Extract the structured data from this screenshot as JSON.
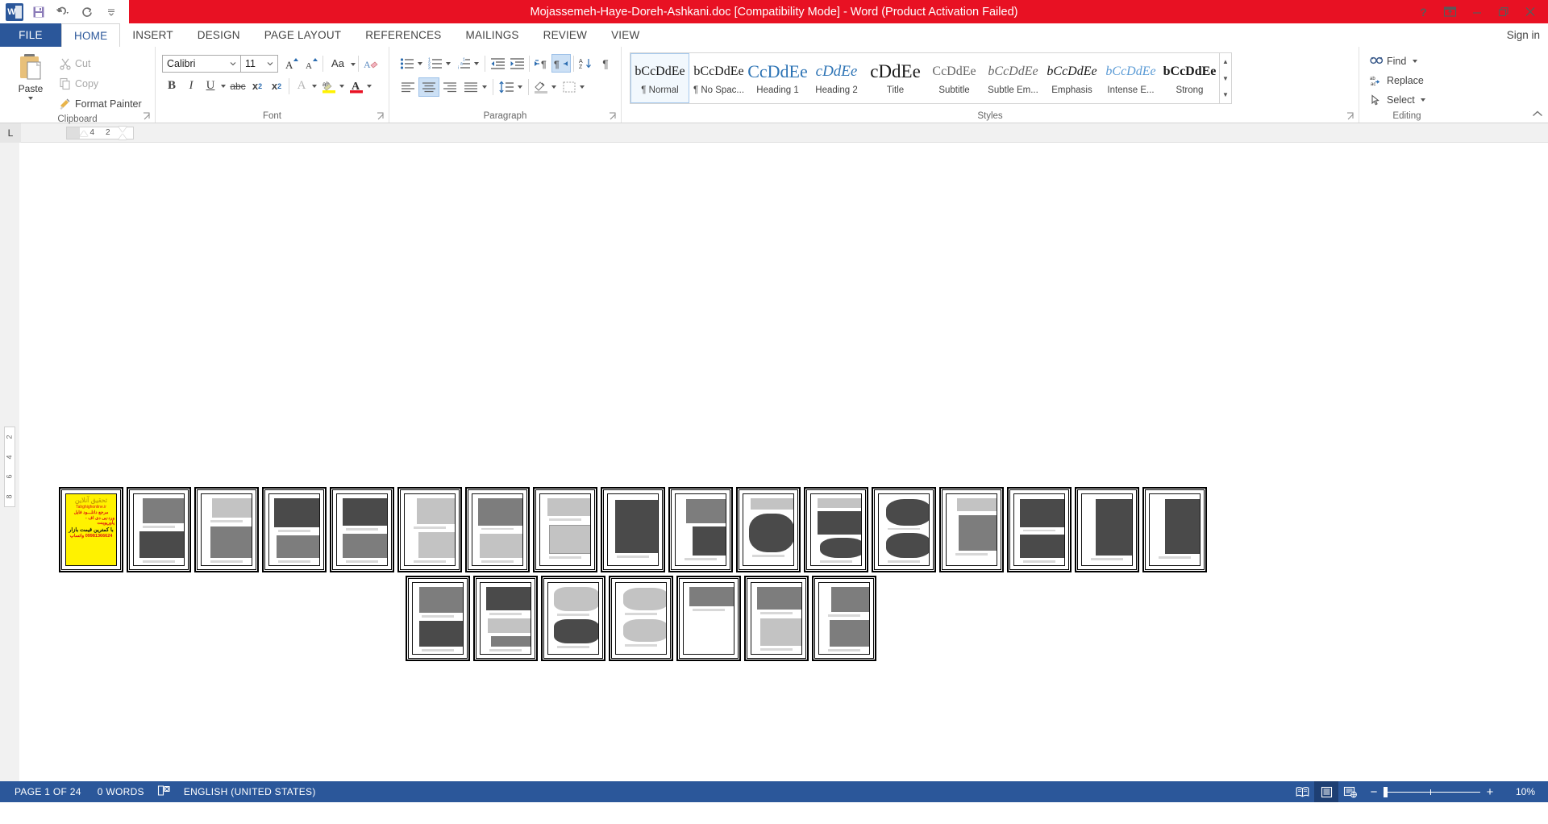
{
  "titlebar": {
    "document_title": "Mojassemeh-Haye-Doreh-Ashkani.doc [Compatibility Mode]  -  Word (Product Activation Failed)",
    "quick_access": [
      {
        "name": "word-logo-icon",
        "label": "W"
      },
      {
        "name": "save-icon",
        "label": "Save"
      },
      {
        "name": "undo-icon",
        "label": "Undo"
      },
      {
        "name": "redo-icon",
        "label": "Redo"
      },
      {
        "name": "customize-qat-icon",
        "label": "Customize Quick Access Toolbar"
      }
    ],
    "window_controls": [
      {
        "name": "help-icon",
        "label": "?"
      },
      {
        "name": "ribbon-display-options-icon",
        "label": "Ribbon Display Options"
      },
      {
        "name": "minimize-icon",
        "label": "Minimize"
      },
      {
        "name": "restore-icon",
        "label": "Restore Down"
      },
      {
        "name": "close-icon",
        "label": "Close"
      }
    ]
  },
  "tabs": {
    "file_label": "FILE",
    "items": [
      {
        "label": "HOME",
        "active": true
      },
      {
        "label": "INSERT",
        "active": false
      },
      {
        "label": "DESIGN",
        "active": false
      },
      {
        "label": "PAGE LAYOUT",
        "active": false
      },
      {
        "label": "REFERENCES",
        "active": false
      },
      {
        "label": "MAILINGS",
        "active": false
      },
      {
        "label": "REVIEW",
        "active": false
      },
      {
        "label": "VIEW",
        "active": false
      }
    ],
    "sign_in": "Sign in"
  },
  "ribbon": {
    "clipboard": {
      "group_label": "Clipboard",
      "paste_label": "Paste",
      "cut_label": "Cut",
      "copy_label": "Copy",
      "format_painter_label": "Format Painter"
    },
    "font": {
      "group_label": "Font",
      "font_family_value": "Calibri",
      "font_size_value": "11",
      "buttons": [
        "grow-font",
        "shrink-font",
        "change-case",
        "clear-formatting",
        "bold",
        "italic",
        "underline",
        "strikethrough",
        "subscript",
        "superscript",
        "text-effects",
        "text-highlight-color",
        "font-color"
      ]
    },
    "paragraph": {
      "group_label": "Paragraph",
      "buttons": [
        "bullets",
        "numbering",
        "multilevel-list",
        "decrease-indent",
        "increase-indent",
        "left-to-right-text-direction",
        "right-to-left-text-direction",
        "sort",
        "show-formatting-marks",
        "align-left",
        "center",
        "align-right",
        "justify",
        "line-spacing",
        "shading",
        "borders"
      ],
      "active": [
        "center",
        "right-to-left-text-direction"
      ]
    },
    "styles": {
      "group_label": "Styles",
      "gallery": [
        {
          "preview": "bCcDdEe",
          "name": "¶ Normal",
          "selected": true,
          "style": "normal"
        },
        {
          "preview": "bCcDdEe",
          "name": "¶ No Spac...",
          "selected": false,
          "style": "normal"
        },
        {
          "preview": "CcDdEe",
          "name": "Heading 1",
          "selected": false,
          "style": "h1"
        },
        {
          "preview": "cDdEe",
          "name": "Heading 2",
          "selected": false,
          "style": "h2"
        },
        {
          "preview": "cDdEe",
          "name": "Title",
          "selected": false,
          "style": "title"
        },
        {
          "preview": "CcDdEe",
          "name": "Subtitle",
          "selected": false,
          "style": "subtitle"
        },
        {
          "preview": "bCcDdEe",
          "name": "Subtle Em...",
          "selected": false,
          "style": "subtleem"
        },
        {
          "preview": "bCcDdEe",
          "name": "Emphasis",
          "selected": false,
          "style": "emphasis"
        },
        {
          "preview": "bCcDdEe",
          "name": "Intense E...",
          "selected": false,
          "style": "intense"
        },
        {
          "preview": "bCcDdEe",
          "name": "Strong",
          "selected": false,
          "style": "strong"
        }
      ]
    },
    "editing": {
      "group_label": "Editing",
      "find_label": "Find",
      "replace_label": "Replace",
      "select_label": "Select"
    },
    "collapse_label": "Collapse the Ribbon"
  },
  "ruler": {
    "tab_selector": "L",
    "horizontal_marks": [
      "4",
      "2"
    ],
    "vertical_marks": [
      "2",
      "4",
      "6",
      "8"
    ]
  },
  "document": {
    "ad_page": {
      "line1": "تحقیق آنلاین",
      "line2": "Tahghighonline.ir",
      "line3": "مرجع دانلـــود فایل",
      "line4": "ورد-پی دی اف - پاورپوینت",
      "line5": "با کمترین قیمت بازار",
      "line6": "09981366624 واتساپ"
    },
    "row1_pages": [
      {
        "n": 1,
        "kind": "ad"
      },
      {
        "n": 2,
        "kind": "two-image"
      },
      {
        "n": 3,
        "kind": "two-image"
      },
      {
        "n": 4,
        "kind": "two-image"
      },
      {
        "n": 5,
        "kind": "two-image"
      },
      {
        "n": 6,
        "kind": "two-image"
      },
      {
        "n": 7,
        "kind": "two-image"
      },
      {
        "n": 8,
        "kind": "two-image"
      },
      {
        "n": 9,
        "kind": "single-image"
      },
      {
        "n": 10,
        "kind": "single-image"
      },
      {
        "n": 11,
        "kind": "two-image"
      },
      {
        "n": 12,
        "kind": "two-image"
      },
      {
        "n": 13,
        "kind": "two-image"
      },
      {
        "n": 14,
        "kind": "single-image"
      },
      {
        "n": 15,
        "kind": "two-image"
      },
      {
        "n": 16,
        "kind": "single-image"
      },
      {
        "n": 17,
        "kind": "single-image"
      }
    ],
    "row2_pages": [
      {
        "n": 18,
        "kind": "two-image"
      },
      {
        "n": 19,
        "kind": "three-image"
      },
      {
        "n": 20,
        "kind": "two-image"
      },
      {
        "n": 21,
        "kind": "two-image"
      },
      {
        "n": 22,
        "kind": "blank-top"
      },
      {
        "n": 23,
        "kind": "two-image"
      },
      {
        "n": 24,
        "kind": "two-image"
      }
    ]
  },
  "statusbar": {
    "page_label": "PAGE 1 OF 24",
    "words_label": "0 WORDS",
    "proofing_icon": "spelling-and-grammar-check-icon",
    "language_label": "ENGLISH (UNITED STATES)",
    "views": [
      {
        "name": "read-mode-view-button",
        "active": false
      },
      {
        "name": "print-layout-view-button",
        "active": true
      },
      {
        "name": "web-layout-view-button",
        "active": false
      }
    ],
    "zoom_out_label": "−",
    "zoom_in_label": "+",
    "zoom_level": "10%"
  }
}
